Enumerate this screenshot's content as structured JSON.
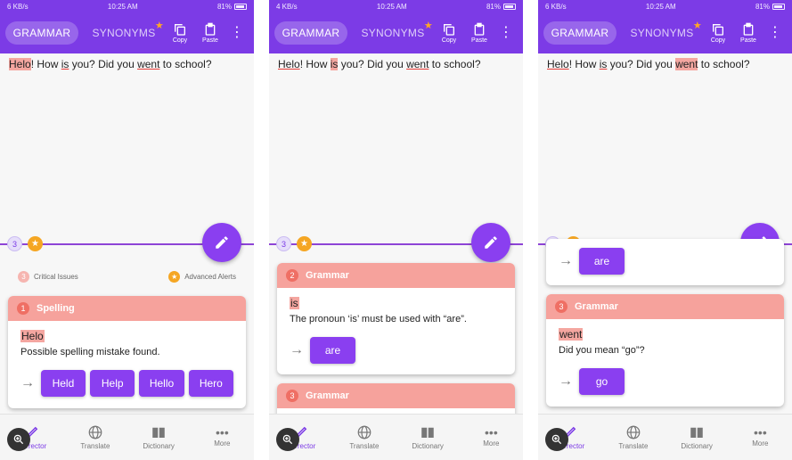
{
  "colors": {
    "brand": "#7c3be6",
    "accent": "#8a3ff0",
    "critical": "#f6a29c",
    "alert": "#f5a623"
  },
  "status": {
    "network": "6 KB/s",
    "network2": "4 KB/s",
    "time": "10:25 AM",
    "battery": "81%"
  },
  "tabs": {
    "grammar": "GRAMMAR",
    "synonyms": "SYNONYMS"
  },
  "tools": {
    "copy": "Copy",
    "paste": "Paste"
  },
  "sentence": {
    "w1": "Helo",
    "p1": "! How ",
    "w2": "is",
    "p2": " you? Did you ",
    "w3": "went",
    "p3": " to school?"
  },
  "counts": {
    "issues": "3"
  },
  "legend": {
    "critical": "Critical Issues",
    "advanced": "Advanced Alerts",
    "critical_count": "3"
  },
  "screen1": {
    "card": {
      "num": "1",
      "title": "Spelling",
      "word": "Helo",
      "message": "Possible spelling mistake found.",
      "suggestions": [
        "Held",
        "Help",
        "Hello",
        "Hero"
      ]
    }
  },
  "screen2": {
    "card": {
      "num": "2",
      "title": "Grammar",
      "word": "is",
      "message": "The pronoun ‘is’ must be used with “are”.",
      "suggestions": [
        "are"
      ]
    },
    "card_next": {
      "num": "3",
      "title": "Grammar"
    }
  },
  "screen3": {
    "prev_suggestion": "are",
    "card": {
      "num": "3",
      "title": "Grammar",
      "word": "went",
      "message": "Did you mean “go”?",
      "suggestions": [
        "go"
      ]
    }
  },
  "nav": {
    "corrector": "Corrector",
    "translate": "Translate",
    "dictionary": "Dictionary",
    "more": "More"
  },
  "icons": {
    "copy": "copy-icon",
    "paste": "paste-icon",
    "more": "kebab-icon",
    "fab": "pencil-icon",
    "zoom": "zoom-in-icon",
    "translate": "globe-icon",
    "dictionary": "book-icon"
  }
}
